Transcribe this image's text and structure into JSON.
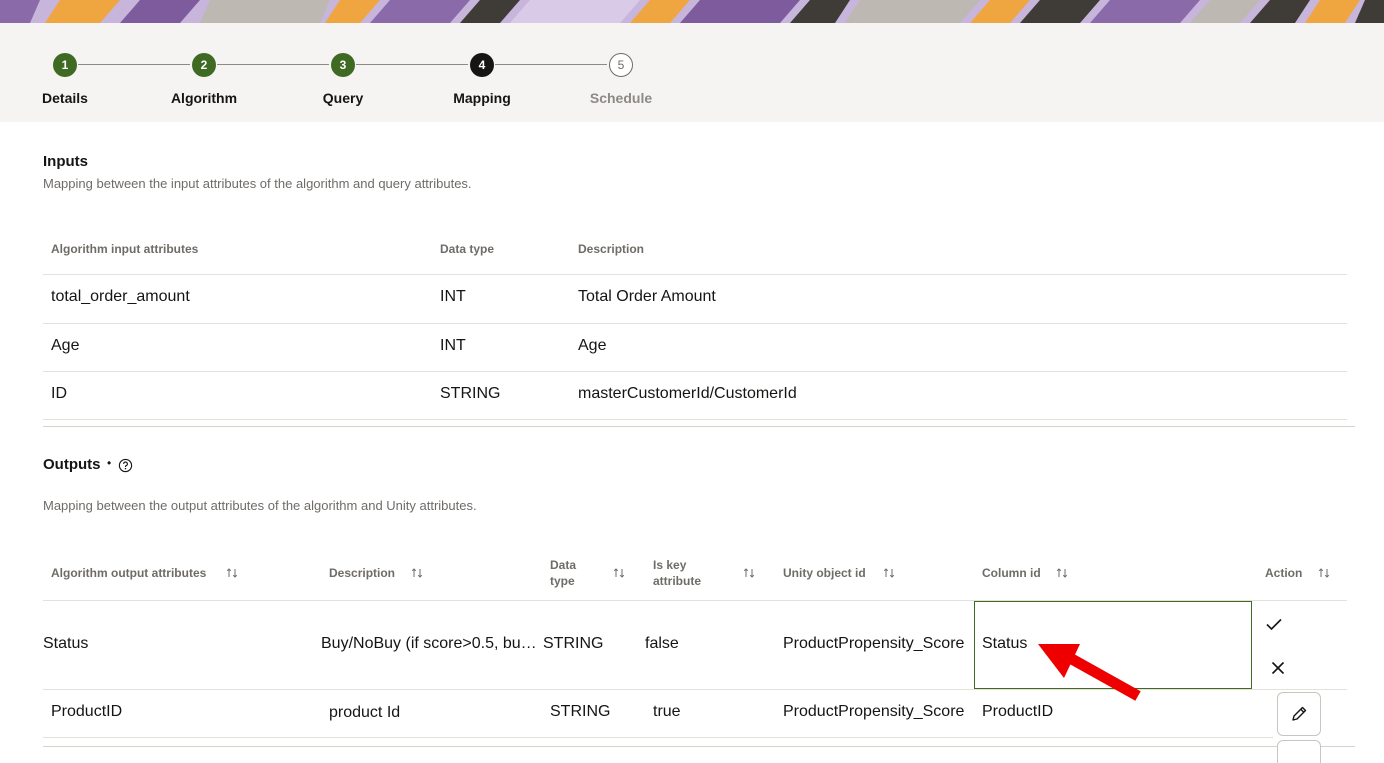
{
  "colors": {
    "done_step": "#3f6a23",
    "current_step": "#161513",
    "annotation_arrow": "#ee0000",
    "edit_border": "#3f6a23"
  },
  "train": {
    "steps": [
      {
        "number": "1",
        "label": "Details",
        "state": "done"
      },
      {
        "number": "2",
        "label": "Algorithm",
        "state": "done"
      },
      {
        "number": "3",
        "label": "Query",
        "state": "done"
      },
      {
        "number": "4",
        "label": "Mapping",
        "state": "current"
      },
      {
        "number": "5",
        "label": "Schedule",
        "state": "todo"
      }
    ]
  },
  "inputs": {
    "title": "Inputs",
    "description": "Mapping between the input attributes of the algorithm and query attributes.",
    "headers": [
      "Algorithm input attributes",
      "Data type",
      "Description"
    ],
    "rows": [
      [
        "total_order_amount",
        "INT",
        "Total Order Amount"
      ],
      [
        "Age",
        "INT",
        "Age"
      ],
      [
        "ID",
        "STRING",
        "masterCustomerId/CustomerId"
      ]
    ]
  },
  "outputs": {
    "title": "Outputs",
    "required_marker": "•",
    "help_icon": "help-circle-icon",
    "description": "Mapping between the output attributes of the algorithm and Unity attributes.",
    "headers": {
      "attr": "Algorithm output attributes",
      "desc": "Description",
      "type1": "Data",
      "type2": "type",
      "key1": "Is key",
      "key2": "attribute",
      "unity": "Unity object id",
      "column": "Column id",
      "action": "Action"
    },
    "rows": [
      {
        "attr": "Status",
        "desc": "Buy/NoBuy (if score>0.5, bu…",
        "type": "STRING",
        "key": "false",
        "unity": "ProductPropensity_Score",
        "column": "Status"
      },
      {
        "attr": "ProductID",
        "desc": "product Id",
        "type": "STRING",
        "key": "true",
        "unity": "ProductPropensity_Score",
        "column": "ProductID"
      }
    ],
    "action_icons": {
      "confirm": "check-icon",
      "cancel": "close-icon",
      "edit": "pencil-icon",
      "sort": "sort-icon"
    }
  }
}
